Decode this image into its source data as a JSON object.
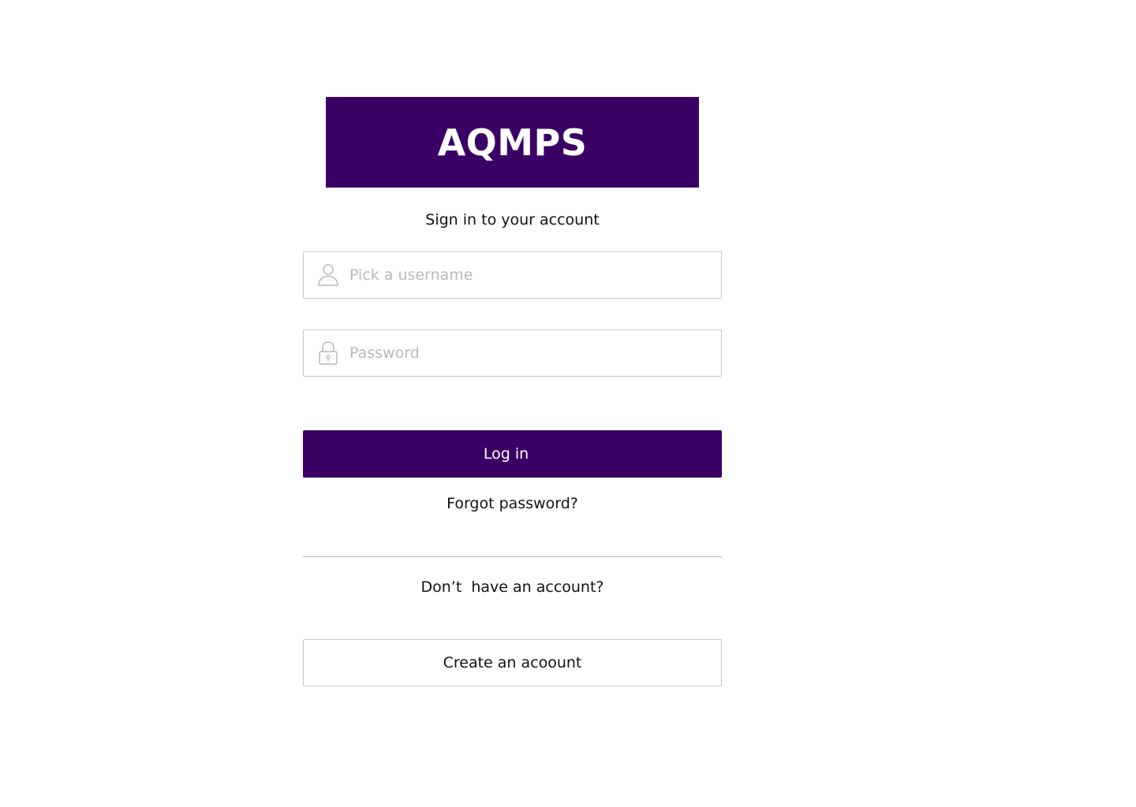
{
  "brand": {
    "name": "AQMPS",
    "color": "#3a0066"
  },
  "form": {
    "subtitle": "Sign in to your account",
    "username": {
      "placeholder": "Pick a username",
      "value": "",
      "icon": "user-icon"
    },
    "password": {
      "placeholder": "Password",
      "value": "",
      "icon": "lock-icon"
    },
    "login_label": "Log in",
    "forgot_label": "Forgot password?"
  },
  "signup": {
    "prompt": "Don’t  have an account?",
    "create_label": "Create an acoount"
  }
}
